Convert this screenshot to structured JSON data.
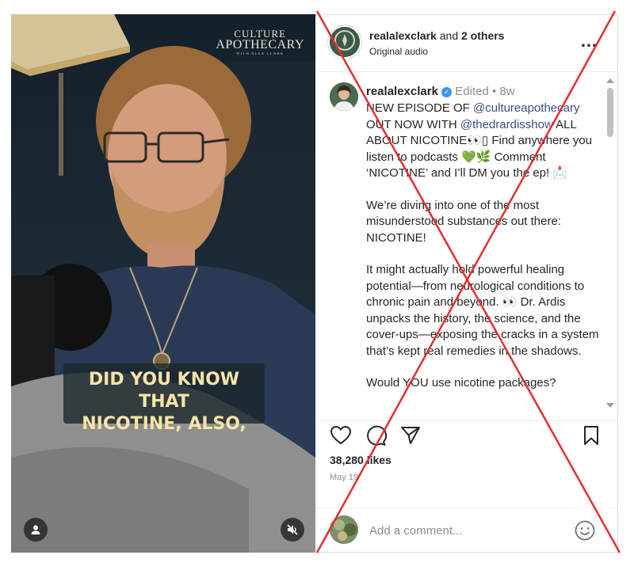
{
  "media": {
    "brand_line1": "CULTURE",
    "brand_line2": "APOTHECARY",
    "brand_line3": "WITH ALEX CLARK",
    "caption_line1": "DID YOU KNOW THAT",
    "caption_line2": "NICOTINE, ALSO,",
    "user_icon": "user-icon",
    "mute_icon": "muted-speaker-icon"
  },
  "header": {
    "username": "realalexclark",
    "and_text": " and ",
    "others": "2 others",
    "subtitle": "Original audio",
    "more": "…"
  },
  "comment": {
    "username": "realalexclark",
    "edited": "Edited",
    "dot": " • ",
    "age": "8w",
    "p1_a": "NEW EPISODE OF ",
    "p1_mention1": "@cultureapothecary",
    "p1_b": " OUT NOW WITH ",
    "p1_mention2": "@thedrardisshow",
    "p1_c": " ALL ABOUT NICOTINE👀▯ Find anywhere you listen to podcasts 💚🌿 Comment ‘NICOTINE’ and I’ll DM you the ep! 📩",
    "p2": "We’re diving into one of the most misunderstood substances out there: NICOTINE!",
    "p3": "It might actually hold powerful healing potential—from neurological conditions to chronic pain and beyond. 👀 Dr. Ardis unpacks the history, the science, and the cover-ups—exposing the cracks in a system that’s kept real remedies in the shadows.",
    "p4": "Would YOU use nicotine packages?"
  },
  "actions": {
    "like_icon": "heart-icon",
    "comment_icon": "comment-icon",
    "share_icon": "paper-plane-icon",
    "save_icon": "bookmark-icon"
  },
  "likes": "38,280 likes",
  "date": "May 19",
  "add_comment": {
    "placeholder": "Add a comment...",
    "emoji_icon": "smiley-icon"
  },
  "colors": {
    "accent_link": "#385185",
    "verified": "#3897f0",
    "overlay_x": "#e2302f",
    "caption_text": "#f6e4a8"
  }
}
